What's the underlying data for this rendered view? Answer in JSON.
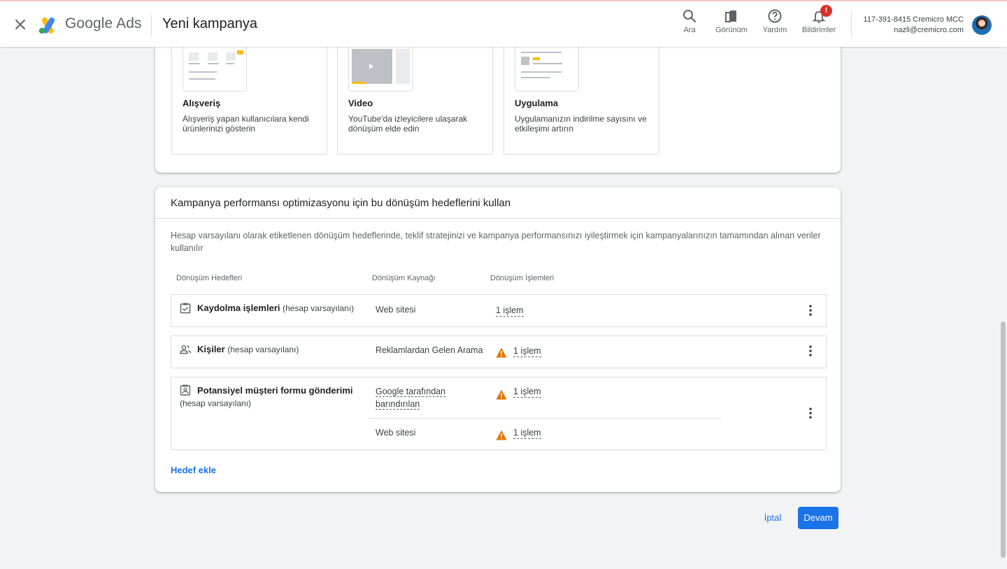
{
  "header": {
    "brand": "Google Ads",
    "page_title": "Yeni kampanya",
    "tools": [
      {
        "label": "Ara",
        "icon": "search-icon"
      },
      {
        "label": "Görünüm",
        "icon": "appearance-icon"
      },
      {
        "label": "Yardım",
        "icon": "help-icon"
      },
      {
        "label": "Bildirimler",
        "icon": "bell-icon",
        "badge": "!"
      }
    ],
    "account_id": "117-391-8415 Cremicro MCC",
    "account_email": "nazli@cremicro.com"
  },
  "campaign_types": [
    {
      "title": "Alışveriş",
      "desc": "Alışveriş yapan kullanıcılara kendi ürünlerinizi gösterin"
    },
    {
      "title": "Video",
      "desc": "YouTube'da izleyicilere ulaşarak dönüşüm elde edin"
    },
    {
      "title": "Uygulama",
      "desc": "Uygulamanızın indirilme sayısını ve etkileşimi artırın"
    }
  ],
  "goals": {
    "title": "Kampanya performansı optimizasyonu için bu dönüşüm hedeflerini kullan",
    "description": "Hesap varsayılanı olarak etiketlenen dönüşüm hedeflerinde, teklif stratejinizi ve kampanya performansınızı iyileştirmek için kampanyalarınızın tamamından alınan veriler kullanılır",
    "columns": [
      "Dönüşüm Hedefleri",
      "Dönüşüm Kaynağı",
      "Dönüşüm İşlemleri"
    ],
    "rows": [
      {
        "name": "Kaydolma işlemleri",
        "default": "(hesap varsayılanı)",
        "source": "Web sitesi",
        "action": "1 işlem"
      },
      {
        "name": "Kişiler",
        "default": "(hesap varsayılanı)",
        "source": "Reklamlardan Gelen Arama",
        "action": "1 işlem"
      },
      {
        "name": "Potansiyel müşteri formu gönderimi",
        "default": "(hesap varsayılanı)",
        "sources": [
          {
            "source": "Google tarafından barındırılan",
            "action": "1 işlem"
          },
          {
            "source": "Web sitesi",
            "action": "1 işlem"
          }
        ]
      }
    ],
    "add_goal": "Hedef ekle"
  },
  "footer": {
    "cancel": "İptal",
    "continue": "Devam"
  },
  "colors": {
    "accent": "#1a73e8",
    "warning": "#e37400",
    "badge": "#d93025"
  }
}
